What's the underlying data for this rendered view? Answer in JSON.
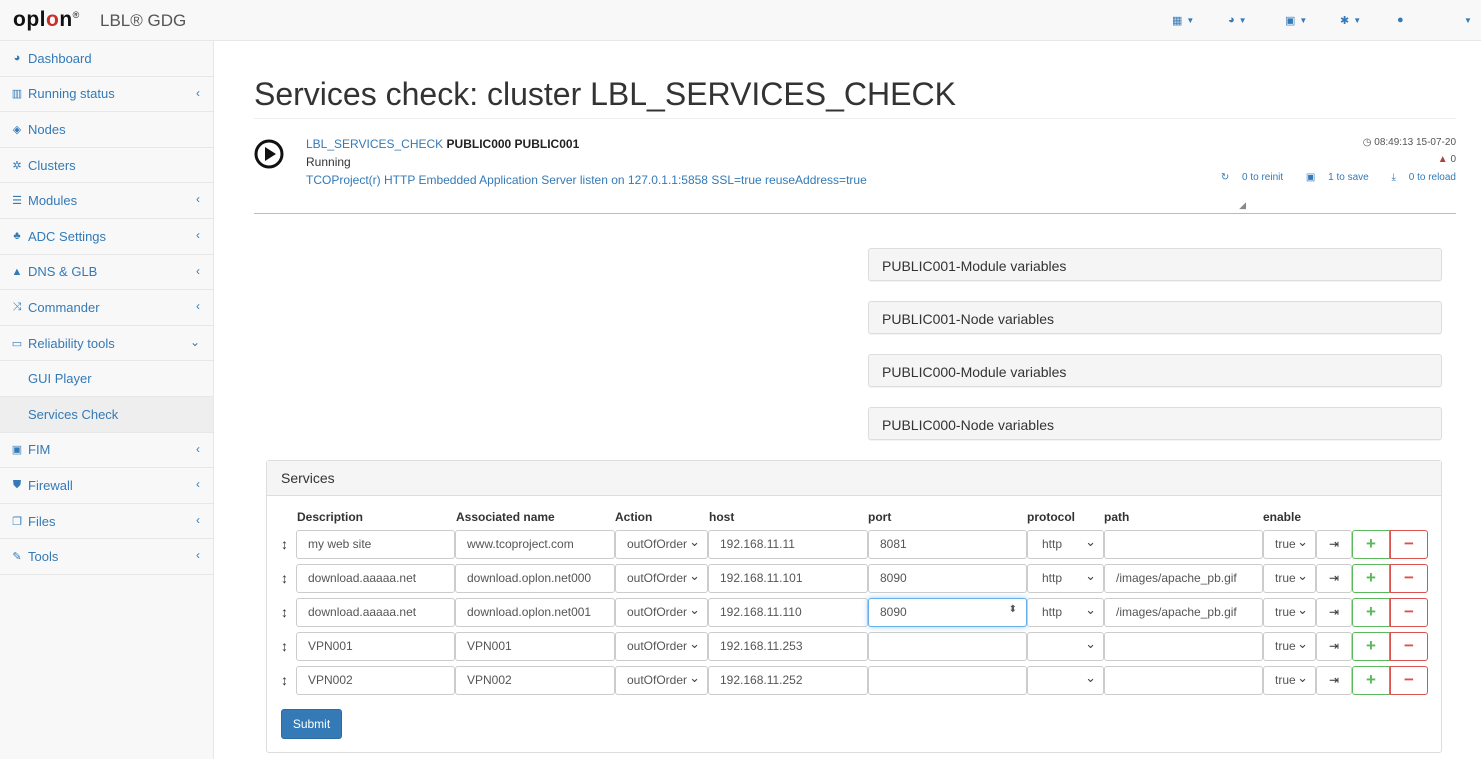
{
  "brand": {
    "logo": "oplon",
    "logo_mark": "®",
    "app_name": "LBL® GDG"
  },
  "topnav": [
    {
      "icon": "grid-icon"
    },
    {
      "icon": "dashboard-icon"
    },
    {
      "icon": "save-icon"
    },
    {
      "icon": "gear-icon"
    },
    {
      "icon": "user-icon"
    }
  ],
  "sidebar": {
    "items": [
      {
        "label": "Dashboard",
        "icon": "dashboard-icon"
      },
      {
        "label": "Running status",
        "icon": "bar-chart-icon",
        "arrow": "‹"
      },
      {
        "label": "Nodes",
        "icon": "cube-icon"
      },
      {
        "label": "Clusters",
        "icon": "cogs-icon"
      },
      {
        "label": "Modules",
        "icon": "list-icon",
        "arrow": "‹"
      },
      {
        "label": "ADC Settings",
        "icon": "sitemap-icon",
        "arrow": "‹"
      },
      {
        "label": "DNS & GLB",
        "icon": "road-icon",
        "arrow": "‹"
      },
      {
        "label": "Commander",
        "icon": "random-icon",
        "arrow": "‹"
      },
      {
        "label": "Reliability tools",
        "icon": "desktop-icon",
        "arrow": "⌄"
      },
      {
        "label": "GUI Player",
        "sub": true
      },
      {
        "label": "Services Check",
        "sub": true,
        "active": true
      },
      {
        "label": "FIM",
        "icon": "camera-icon",
        "arrow": "‹"
      },
      {
        "label": "Firewall",
        "icon": "shield-icon",
        "arrow": "‹"
      },
      {
        "label": "Files",
        "icon": "files-icon",
        "arrow": "‹"
      },
      {
        "label": "Tools",
        "icon": "wrench-icon",
        "arrow": "‹"
      }
    ]
  },
  "main": {
    "title": "Services check: cluster LBL_SERVICES_CHECK",
    "status": {
      "cluster_link": "LBL_SERVICES_CHECK",
      "nodes": "PUBLIC000 PUBLIC001",
      "state": "Running",
      "message": "TCOProject(r) HTTP Embedded Application Server listen on 127.0.1.1:5858 SSL=true reuseAddress=true",
      "time": "08:49:13 15-07-20",
      "warnings": "0",
      "reinit": "0 to reinit",
      "save": "1 to save",
      "reload": "0 to reload"
    },
    "panels": [
      "PUBLIC001-Module variables",
      "PUBLIC001-Node variables",
      "PUBLIC000-Module variables",
      "PUBLIC000-Node variables"
    ],
    "services": {
      "heading": "Services",
      "columns": [
        "Description",
        "Associated name",
        "Action",
        "host",
        "port",
        "protocol",
        "path",
        "enable"
      ],
      "rows": [
        {
          "description": "my web site",
          "associated": "www.tcoproject.com",
          "action": "outOfOrder",
          "host": "192.168.11.11",
          "port": "8081",
          "protocol": "http",
          "path": "",
          "enable": "true"
        },
        {
          "description": "download.aaaaa.net",
          "associated": "download.oplon.net000",
          "action": "outOfOrder",
          "host": "192.168.11.101",
          "port": "8090",
          "protocol": "http",
          "path": "/images/apache_pb.gif",
          "enable": "true"
        },
        {
          "description": "download.aaaaa.net",
          "associated": "download.oplon.net001",
          "action": "outOfOrder",
          "host": "192.168.11.110",
          "port": "8090",
          "protocol": "http",
          "path": "/images/apache_pb.gif",
          "enable": "true"
        },
        {
          "description": "VPN001",
          "associated": "VPN001",
          "action": "outOfOrder",
          "host": "192.168.11.253",
          "port": "",
          "protocol": "",
          "path": "",
          "enable": "true"
        },
        {
          "description": "VPN002",
          "associated": "VPN002",
          "action": "outOfOrder",
          "host": "192.168.11.252",
          "port": "",
          "protocol": "",
          "path": "",
          "enable": "true"
        }
      ],
      "submit": "Submit"
    }
  }
}
